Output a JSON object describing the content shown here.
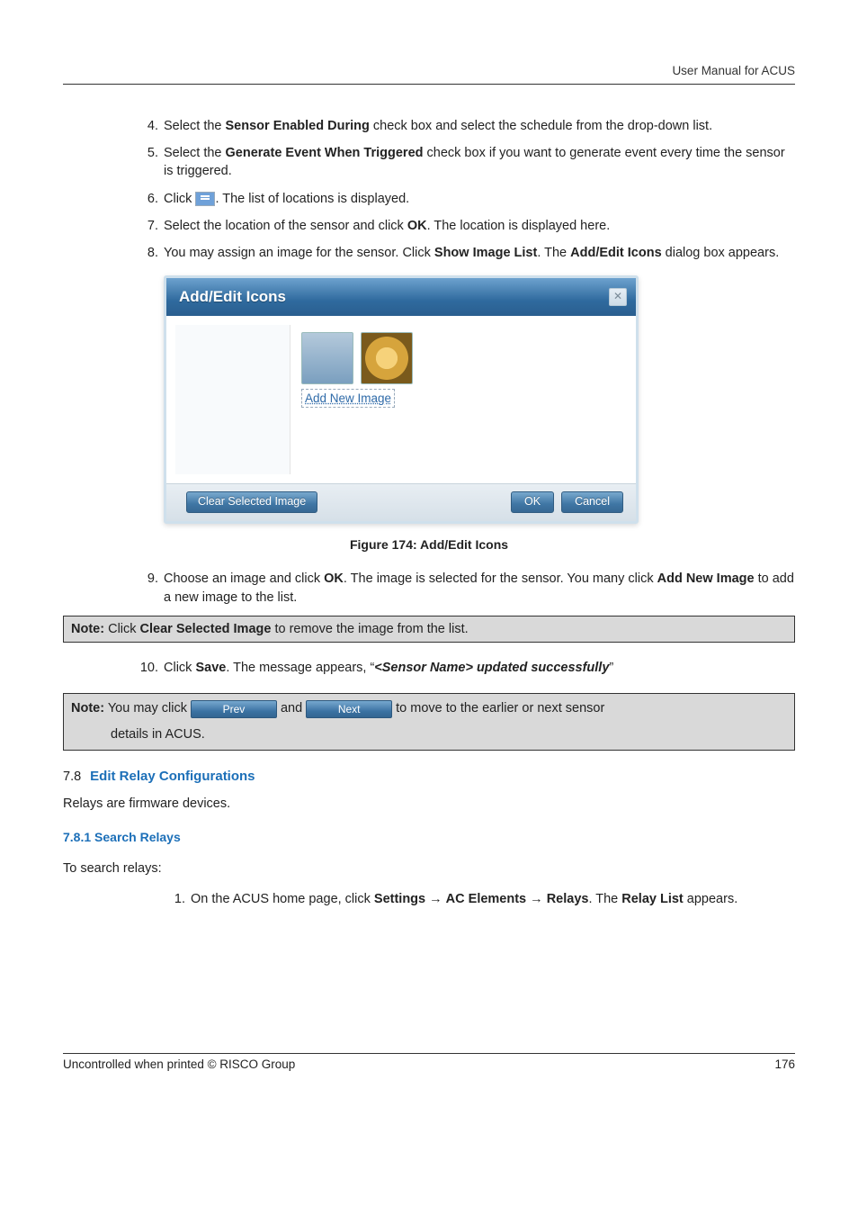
{
  "header": {
    "right_text": "User Manual for ACUS"
  },
  "steps_a": [
    {
      "pre": "Select the ",
      "b1": "Sensor Enabled During",
      "post": " check box and select the schedule from the drop-down list."
    },
    {
      "pre": "Select the ",
      "b1": "Generate Event When Triggered",
      "post": " check box if you want to generate event every time the sensor is triggered."
    },
    {
      "pre": "Click ",
      "icon": true,
      "post": ". The list of locations is displayed."
    },
    {
      "pre": "Select the location of the sensor and click ",
      "b1": "OK",
      "post": ". The location is displayed here."
    },
    {
      "pre": "You may assign an image for the sensor. Click ",
      "b1": "Show Image List",
      "mid": ". The ",
      "b2": "Add/Edit Icons",
      "post": " dialog box appears."
    }
  ],
  "dialog": {
    "title": "Add/Edit Icons",
    "close_glyph": "✕",
    "add_link": "Add New Image",
    "clear_btn": "Clear Selected Image",
    "ok_btn": "OK",
    "cancel_btn": "Cancel"
  },
  "figure_caption": "Figure 174: Add/Edit Icons",
  "step9": {
    "pre": "Choose an image and click ",
    "b1": "OK",
    "mid": ". The image is selected for the sensor. You many click ",
    "b2": "Add New Image",
    "post": " to add a new image to the list."
  },
  "note1": {
    "label": "Note:",
    "pre": " Click ",
    "b1": "Clear Selected Image",
    "post": " to remove the image from the list."
  },
  "step10": {
    "pre": "Click ",
    "b1": "Save",
    "mid": ". The message appears, “",
    "bi": "<Sensor Name> updated successfully",
    "post": "”"
  },
  "note2": {
    "label": "Note:",
    "pre": " You may click ",
    "prev_btn": "Prev",
    "and": " and ",
    "next_btn": "Next",
    "post": " to move to the earlier or next sensor",
    "line2": "details in ACUS."
  },
  "section78": {
    "num": "7.8",
    "title": "Edit Relay Configurations",
    "intro": "Relays are firmware devices."
  },
  "section781": {
    "num_title": "7.8.1  Search Relays",
    "intro": "To search relays:"
  },
  "step_relay": {
    "pre": "On the ACUS home page, click ",
    "b1": "Settings",
    "arr1": " → ",
    "b2": "AC Elements",
    "arr2": " → ",
    "b3": "Relays",
    "mid": ". The ",
    "b4": "Relay List",
    "post": " appears."
  },
  "footer": {
    "left": "Uncontrolled when printed © RISCO Group",
    "right": "176"
  }
}
